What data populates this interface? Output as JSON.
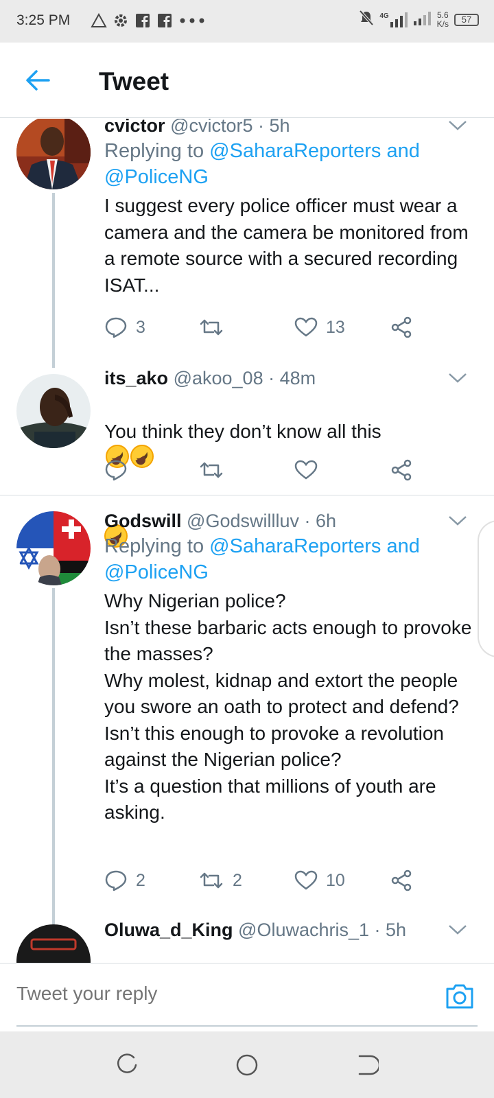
{
  "status_bar": {
    "time": "3:25 PM",
    "network": "4G",
    "speed_value": "5.6",
    "speed_unit": "K/s",
    "battery": "57"
  },
  "header": {
    "title": "Tweet"
  },
  "tweets": [
    {
      "name": "cvictor",
      "handle": "@cvictor5",
      "time": "· 5h",
      "replying_prefix": "Replying to",
      "replying_mentions": "@SaharaReporters and @PoliceNG",
      "text": "I suggest every police officer must wear a camera and the camera be monitored from a remote source with a secured recording ISAT...",
      "replies": "3",
      "retweets": "",
      "likes": "13"
    },
    {
      "name": "its_ako",
      "handle": "@akoo_08",
      "time": "· 48m",
      "text": "You think they don’t know all this",
      "replies": "",
      "retweets": "",
      "likes": ""
    },
    {
      "name": "Godswill",
      "handle": "@Godswillluv",
      "time": "· 6h",
      "replying_prefix": "Replying to",
      "replying_mentions": "@SaharaReporters and @PoliceNG",
      "text": "Why Nigerian police?\nIsn’t these barbaric acts enough to provoke the masses?\nWhy molest, kidnap and extort the people you swore an oath to protect and defend?\nIsn’t this enough to provoke a revolution against the Nigerian police?\nIt’s a question that millions of youth are asking.",
      "replies": "2",
      "retweets": "2",
      "likes": "10"
    },
    {
      "name": "Oluwa_d_King",
      "handle": "@Oluwachris_1",
      "time": "· 5h"
    }
  ],
  "reply_bar": {
    "placeholder": "Tweet your reply"
  },
  "colors": {
    "accent": "#1da1f2",
    "text_primary": "#14171a",
    "text_secondary": "#657786",
    "divider": "#d8dde1"
  }
}
